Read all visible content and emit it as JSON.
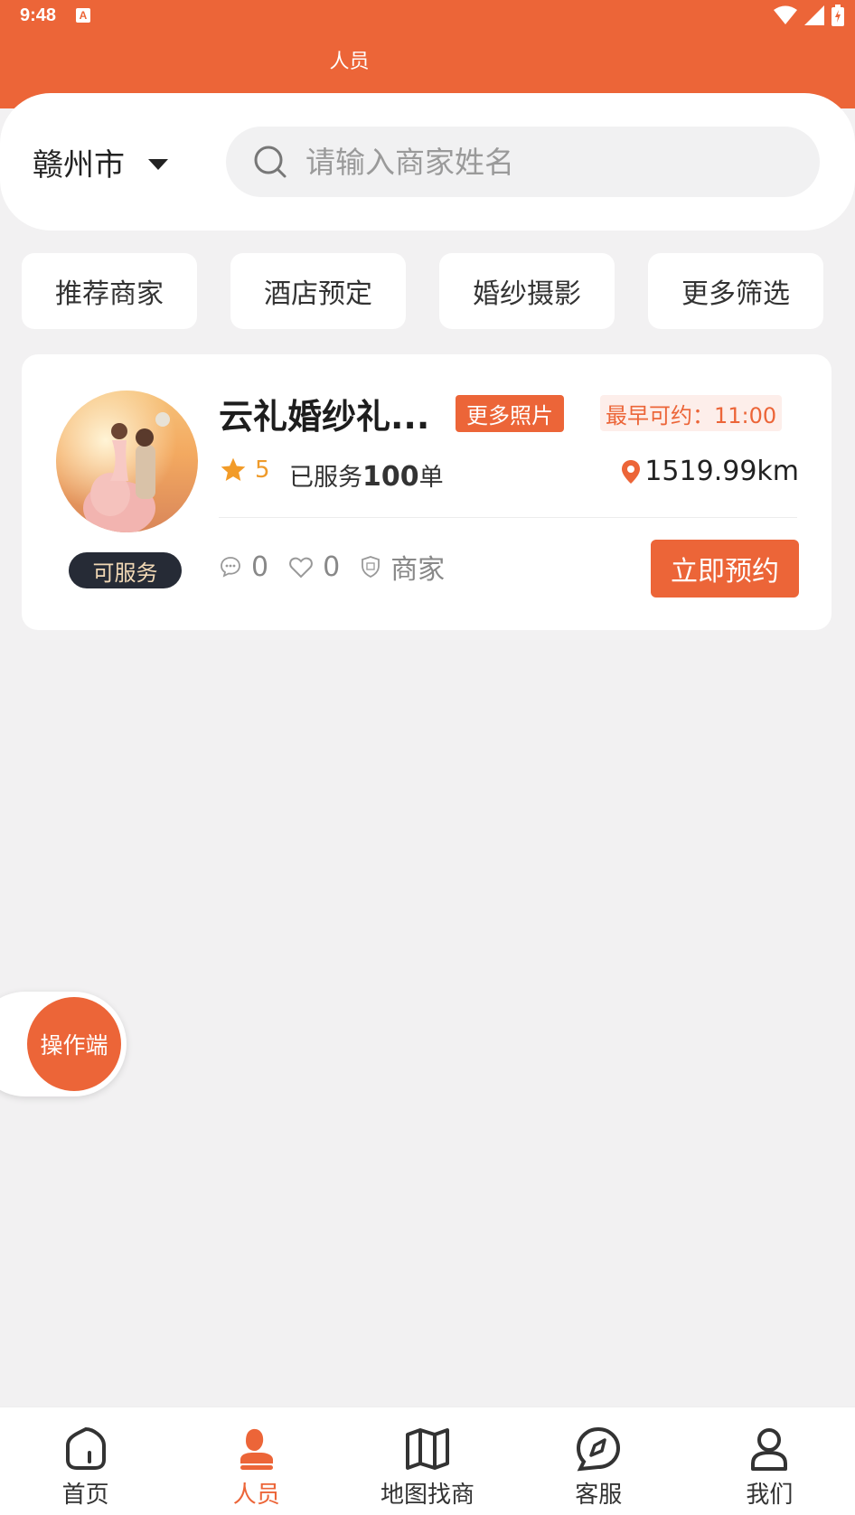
{
  "status_bar": {
    "time": "9:48",
    "notification_letter": "A"
  },
  "header": {
    "title": "人员"
  },
  "location": {
    "city": "赣州市"
  },
  "search": {
    "placeholder": "请输入商家姓名"
  },
  "filters": [
    {
      "label": "推荐商家"
    },
    {
      "label": "酒店预定"
    },
    {
      "label": "婚纱摄影"
    },
    {
      "label": "更多筛选"
    }
  ],
  "merchant": {
    "name": "云礼婚纱礼...",
    "photos_tag": "更多照片",
    "earliest_tag": "最早可约：11:00",
    "rating": "5",
    "served_prefix": "已服务",
    "served_count": "100",
    "served_suffix": "单",
    "distance": "1519.99km",
    "status_badge": "可服务",
    "comments": "0",
    "likes": "0",
    "type_label": "商家",
    "book_label": "立即预约"
  },
  "float_button": {
    "label": "操作端"
  },
  "bottom_nav": {
    "items": [
      {
        "label": "首页",
        "icon": "home-icon"
      },
      {
        "label": "人员",
        "icon": "person-icon"
      },
      {
        "label": "地图找商",
        "icon": "map-icon"
      },
      {
        "label": "客服",
        "icon": "compass-icon"
      },
      {
        "label": "我们",
        "icon": "user-icon"
      }
    ],
    "active": "人员"
  },
  "colors": {
    "accent": "#ec6538",
    "background": "#f2f1f2",
    "badge_dark": "#262b36",
    "rating": "#ef9b2b"
  }
}
